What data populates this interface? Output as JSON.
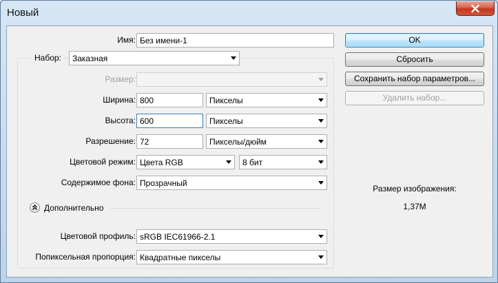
{
  "window": {
    "title": "Новый"
  },
  "labels": {
    "name": "Имя:",
    "preset": "Набор:",
    "size": "Размер:",
    "width": "Ширина:",
    "height": "Высота:",
    "resolution": "Разрешение:",
    "color_mode": "Цветовой режим:",
    "background": "Содержимое фона:",
    "advanced": "Дополнительно",
    "color_profile": "Цветовой профиль:",
    "pixel_aspect": "Попиксельная пропорция:"
  },
  "fields": {
    "name": "Без имени-1",
    "preset": "Заказная",
    "size": "",
    "width": "800",
    "width_unit": "Пикселы",
    "height": "600",
    "height_unit": "Пикселы",
    "resolution": "72",
    "resolution_unit": "Пикселы/дюйм",
    "color_mode": "Цвета RGB",
    "bit_depth": "8 бит",
    "background": "Прозрачный",
    "color_profile": "sRGB IEC61966-2.1",
    "pixel_aspect": "Квадратные пикселы"
  },
  "buttons": {
    "ok": "OK",
    "reset": "Сбросить",
    "save_preset": "Сохранить набор параметров...",
    "delete_preset": "Удалить набор..."
  },
  "image_size": {
    "label": "Размер изображения:",
    "value": "1,37M"
  }
}
